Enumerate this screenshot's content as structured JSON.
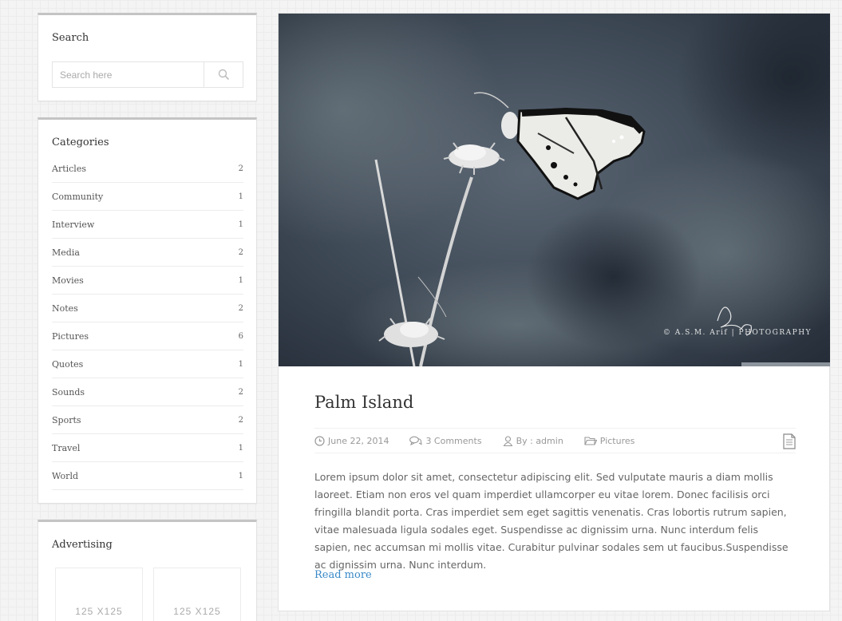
{
  "sidebar": {
    "search": {
      "title": "Search",
      "placeholder": "Search here"
    },
    "categories": {
      "title": "Categories",
      "items": [
        {
          "label": "Articles",
          "count": "2"
        },
        {
          "label": "Community",
          "count": "1"
        },
        {
          "label": "Interview",
          "count": "1"
        },
        {
          "label": "Media",
          "count": "2"
        },
        {
          "label": "Movies",
          "count": "1"
        },
        {
          "label": "Notes",
          "count": "2"
        },
        {
          "label": "Pictures",
          "count": "6"
        },
        {
          "label": "Quotes",
          "count": "1"
        },
        {
          "label": "Sounds",
          "count": "2"
        },
        {
          "label": "Sports",
          "count": "2"
        },
        {
          "label": "Travel",
          "count": "1"
        },
        {
          "label": "World",
          "count": "1"
        }
      ]
    },
    "advertising": {
      "title": "Advertising",
      "ads": [
        "125 X125",
        "125 X125"
      ]
    }
  },
  "post": {
    "image": {
      "watermark_signature": "Arif",
      "watermark_text": "© A.S.M. Arif | PHOTOGRAPHY"
    },
    "title": "Palm Island",
    "meta": {
      "date": "June 22, 2014",
      "comments": "3 Comments",
      "author": "By : admin",
      "category": "Pictures"
    },
    "excerpt": "Lorem ipsum dolor sit amet, consectetur adipiscing elit. Sed vulputate mauris a diam mollis laoreet. Etiam non eros vel quam imperdiet ullamcorper eu vitae lorem. Donec facilisis orci fringilla blandit porta. Cras imperdiet sem eget sagittis venenatis. Cras lobortis rutrum sapien, vitae malesuada ligula sodales eget. Suspendisse ac dignissim urna. Nunc interdum felis sapien, nec accumsan mi mollis vitae. Curabitur pulvinar sodales sem ut faucibus.Suspendisse ac dignissim urna. Nunc interdum.",
    "read_more": "Read more"
  },
  "colors": {
    "link": "#3a8ac8",
    "widget_border_top": "#c4c4c4",
    "meta_text": "#999999"
  }
}
